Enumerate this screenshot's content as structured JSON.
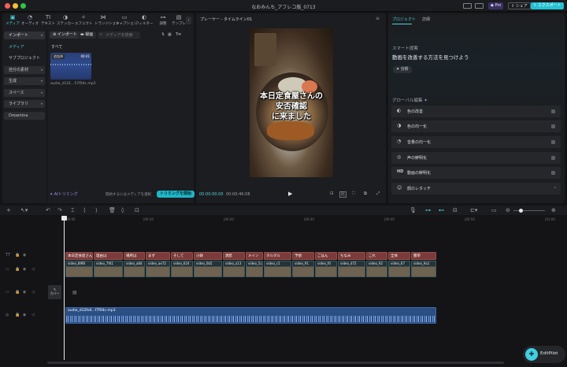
{
  "window": {
    "title": "なおみんち_アフレコ版_0713"
  },
  "topbar": {
    "pro_label": "Pro",
    "share_label": "シェア",
    "export_label": "エクスポート"
  },
  "toolbar": {
    "tools": [
      {
        "label": "メディア",
        "glyph": "▣"
      },
      {
        "label": "オーディオ",
        "glyph": "◔"
      },
      {
        "label": "テキスト",
        "glyph": "TI"
      },
      {
        "label": "ステッカー",
        "glyph": "◑"
      },
      {
        "label": "エフェクト",
        "glyph": "✧"
      },
      {
        "label": "トランジション",
        "glyph": "⋈"
      },
      {
        "label": "キャプション",
        "glyph": "▭"
      },
      {
        "label": "フィルター",
        "glyph": "◐"
      },
      {
        "label": "調整",
        "glyph": "⊶"
      },
      {
        "label": "テンプレ",
        "glyph": "▤"
      }
    ]
  },
  "media_sidebar": {
    "items": [
      {
        "label": "インポート",
        "caret": "▾"
      },
      {
        "label": "メディア",
        "caret": ""
      },
      {
        "label": "サブプロジェクト",
        "caret": ""
      },
      {
        "label": "自分の素材",
        "caret": "▾"
      },
      {
        "label": "生成",
        "caret": "▾"
      },
      {
        "label": "スペース",
        "caret": "▾"
      },
      {
        "label": "ライブラリ",
        "caret": "▾"
      },
      {
        "label": "Dreamina",
        "caret": ""
      }
    ]
  },
  "media_pane": {
    "import_label": "インポート",
    "record_label": "録画",
    "search_placeholder": "メディアを検索",
    "all_label": "すべて",
    "added_badge": "追加済",
    "duration": "00:41",
    "asset_name": "audio_d131...57f04c.mp3",
    "ai_trim_label": "AIトリミング",
    "hint": "開始するにはメディアを選択",
    "trim_start_label": "トリミングを開始"
  },
  "player": {
    "title": "プレーヤー - タイムライン01",
    "caption_lines": [
      "本日定食屋さんの",
      "安否確認",
      "に来ました"
    ],
    "current_time": "00:00:00:00",
    "total_time": "00:00:46:08"
  },
  "right_panel": {
    "tab_project": "プロジェクト",
    "tab_detail": "詳細",
    "smart_heading": "スマート提案",
    "smart_title": "動画を改善する方法を見つけよう",
    "analyze_label": "分析",
    "global_heading": "グローバル編集",
    "items": [
      {
        "label": "色の改善",
        "icon": "◐"
      },
      {
        "label": "色の均一化",
        "icon": "◑"
      },
      {
        "label": "音量の均一化",
        "icon": "◔"
      },
      {
        "label": "声の鮮明化",
        "icon": "◎"
      },
      {
        "label": "動画の鮮明化",
        "icon": "HD"
      },
      {
        "label": "顔のレタッチ",
        "icon": "☺"
      }
    ]
  },
  "timeline": {
    "ruler": [
      "00:00",
      "|00:10",
      "|00:20",
      "|00:30",
      "|00:40",
      "|00:50",
      "|01:00"
    ],
    "text_clips": [
      "本日定食屋さんの安否確認",
      "理由は",
      "場所は",
      "まず",
      "そして",
      "小鉢",
      "黒酢",
      "メイン",
      "タルタル",
      "予想",
      "ごはん",
      "ちなみ",
      "これ",
      "全体",
      "簡単"
    ],
    "video_clips": [
      "video_89f8",
      "video_7f41",
      "video_a8d",
      "video_ae72",
      "video_624",
      "video_0b5",
      "video_a13",
      "video_5ca",
      "video_c1",
      "video_91",
      "video_f0",
      "video_d72",
      "video_92",
      "video_67",
      "video_9a1"
    ],
    "cover_label": "カバー",
    "audio_clip": "audio_d12fe4...f7f04c.mp3"
  },
  "editpilot": {
    "label": "EditPilot"
  },
  "colors": {
    "accent": "#4fd1dd",
    "text_clip": "#7a3b3a",
    "audio_clip": "#2a4f85",
    "export": "#22c1d3"
  }
}
